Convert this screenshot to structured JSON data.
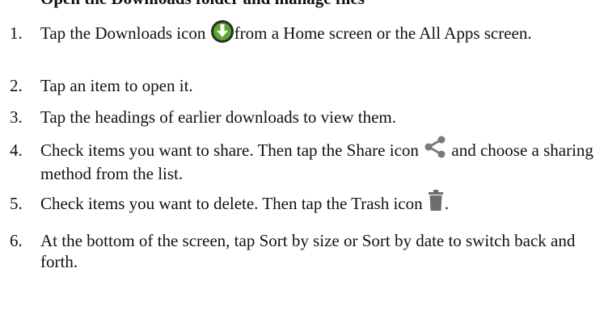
{
  "section": {
    "heading": "Open the Downloads folder and manage files"
  },
  "steps": [
    {
      "num": "1.",
      "before": "Tap the Downloads icon ",
      "icon": "downloads-icon",
      "after": "from a Home screen or the All Apps screen."
    },
    {
      "num": "2.",
      "text": "Tap an item to open it."
    },
    {
      "num": "3.",
      "text": "Tap the headings of earlier downloads to view them."
    },
    {
      "num": "4.",
      "before": "Check items you want to share. Then tap the Share icon ",
      "icon": "share-icon",
      "after": " and choose a sharing method from the list."
    },
    {
      "num": "5.",
      "before": "Check items you want to delete. Then tap the Trash icon ",
      "icon": "trash-icon",
      "after": "."
    },
    {
      "num": "6.",
      "text": "At the bottom of the screen, tap Sort by size or Sort by date to switch back and forth."
    }
  ],
  "colors": {
    "download_green": "#5aa829",
    "icon_dark": "#2b2b2b",
    "share_gray": "#7a7a7a",
    "trash_gray": "#6e6e6e"
  }
}
